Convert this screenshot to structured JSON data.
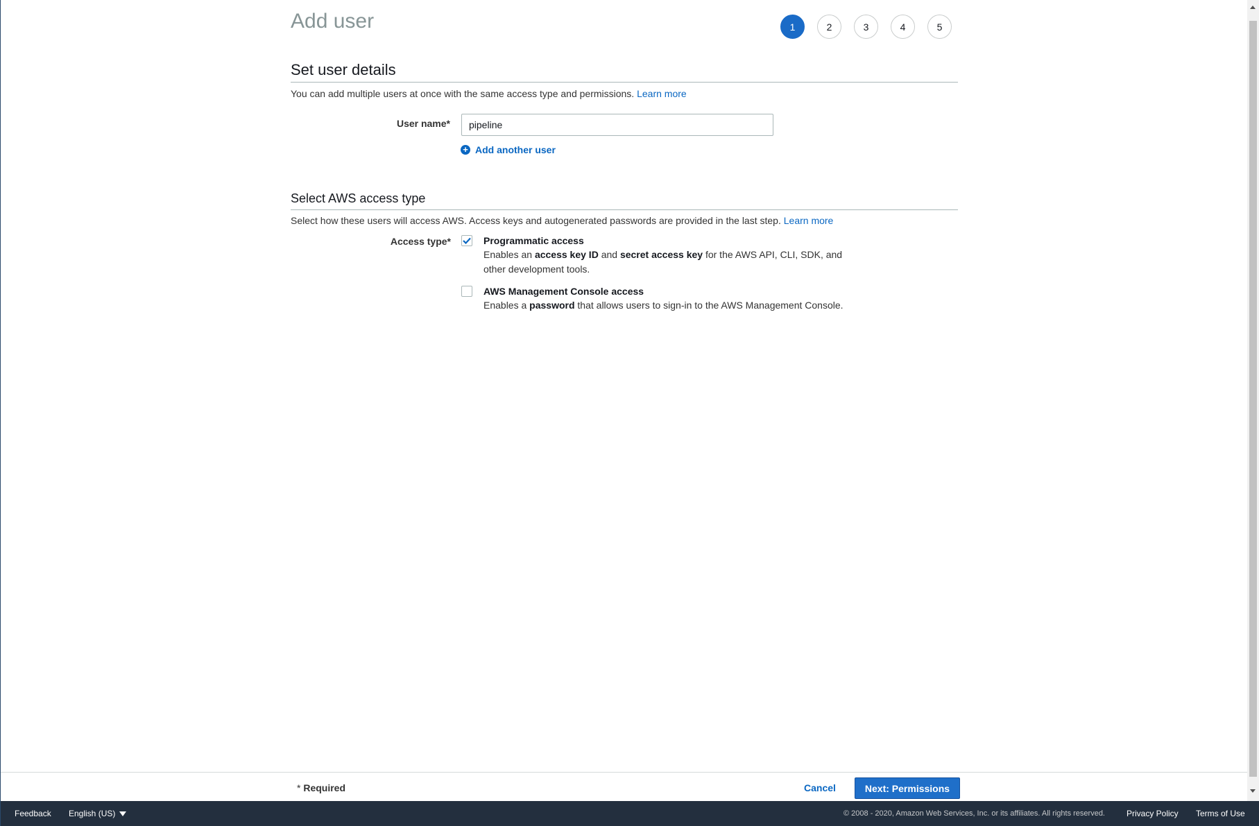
{
  "page": {
    "title": "Add user"
  },
  "steps": [
    "1",
    "2",
    "3",
    "4",
    "5"
  ],
  "details": {
    "title": "Set user details",
    "description": "You can add multiple users at once with the same access type and permissions.",
    "learn_more": "Learn more",
    "username_label": "User name*",
    "username_value": "pipeline",
    "add_another": "Add another user"
  },
  "access": {
    "title": "Select AWS access type",
    "description": "Select how these users will access AWS. Access keys and autogenerated passwords are provided in the last step.",
    "learn_more": "Learn more",
    "type_label": "Access type*",
    "programmatic": {
      "title": "Programmatic access",
      "checked": true,
      "desc_1": "Enables an ",
      "desc_b1": "access key ID",
      "desc_2": " and ",
      "desc_b2": "secret access key",
      "desc_3": " for the AWS API, CLI, SDK, and other development tools."
    },
    "console": {
      "title": "AWS Management Console access",
      "checked": false,
      "desc_1": "Enables a ",
      "desc_b1": "password",
      "desc_2": " that allows users to sign-in to the AWS Management Console."
    }
  },
  "actions": {
    "required_mark": "*",
    "required_text": " Required",
    "cancel": "Cancel",
    "next": "Next: Permissions"
  },
  "footer": {
    "feedback": "Feedback",
    "language": "English (US)",
    "copyright": "© 2008 - 2020, Amazon Web Services, Inc. or its affiliates. All rights reserved.",
    "privacy": "Privacy Policy",
    "terms": "Terms of Use"
  },
  "colors": {
    "primary": "#1f6fc9",
    "link": "#0a67c2",
    "footer_bg": "#232f3e"
  }
}
